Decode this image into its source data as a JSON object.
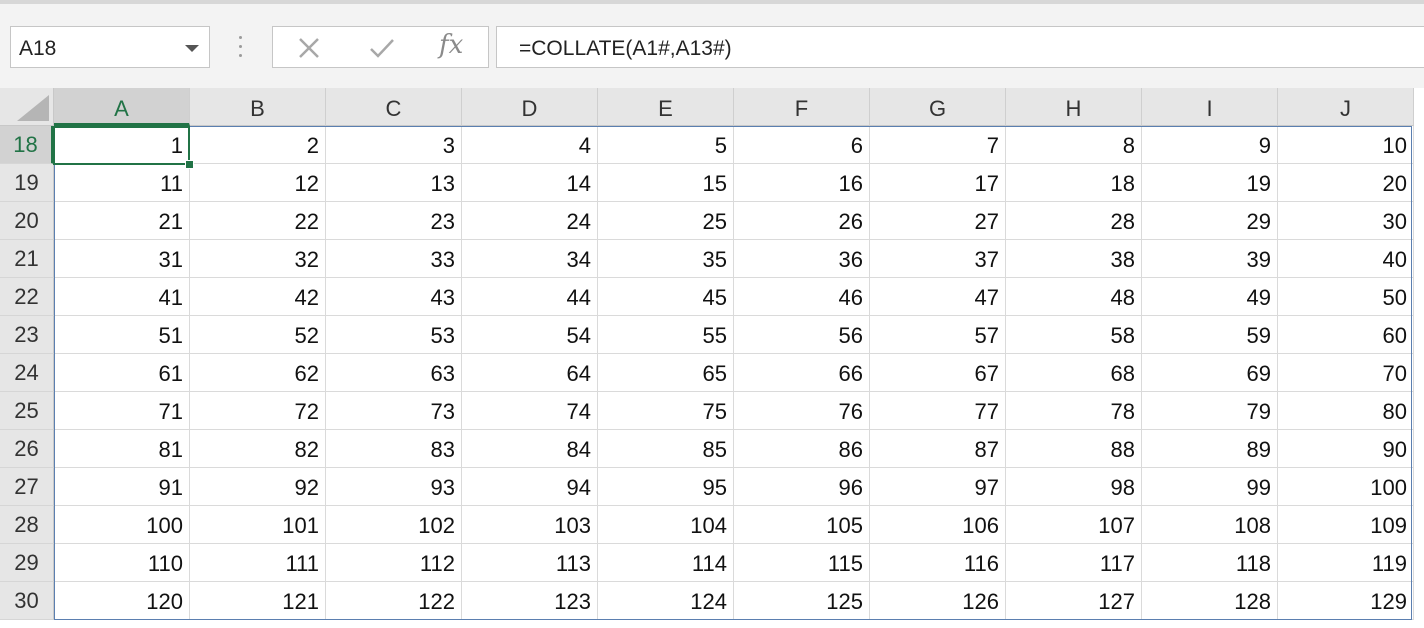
{
  "name_box": {
    "value": "A18"
  },
  "formula_bar": {
    "formula": "=COLLATE(A1#,A13#)",
    "fx_label": "fx"
  },
  "icons": {
    "cancel": "close-icon",
    "enter": "check-icon",
    "function": "fx-icon",
    "dropdown": "chevron-down-icon"
  },
  "colors": {
    "accent": "#217346",
    "spill_border": "#5b7fb0"
  },
  "selected_cell": "A18",
  "columns": [
    "A",
    "B",
    "C",
    "D",
    "E",
    "F",
    "G",
    "H",
    "I",
    "J"
  ],
  "rows": [
    {
      "label": "18",
      "values": [
        "1",
        "2",
        "3",
        "4",
        "5",
        "6",
        "7",
        "8",
        "9",
        "10"
      ]
    },
    {
      "label": "19",
      "values": [
        "11",
        "12",
        "13",
        "14",
        "15",
        "16",
        "17",
        "18",
        "19",
        "20"
      ]
    },
    {
      "label": "20",
      "values": [
        "21",
        "22",
        "23",
        "24",
        "25",
        "26",
        "27",
        "28",
        "29",
        "30"
      ]
    },
    {
      "label": "21",
      "values": [
        "31",
        "32",
        "33",
        "34",
        "35",
        "36",
        "37",
        "38",
        "39",
        "40"
      ]
    },
    {
      "label": "22",
      "values": [
        "41",
        "42",
        "43",
        "44",
        "45",
        "46",
        "47",
        "48",
        "49",
        "50"
      ]
    },
    {
      "label": "23",
      "values": [
        "51",
        "52",
        "53",
        "54",
        "55",
        "56",
        "57",
        "58",
        "59",
        "60"
      ]
    },
    {
      "label": "24",
      "values": [
        "61",
        "62",
        "63",
        "64",
        "65",
        "66",
        "67",
        "68",
        "69",
        "70"
      ]
    },
    {
      "label": "25",
      "values": [
        "71",
        "72",
        "73",
        "74",
        "75",
        "76",
        "77",
        "78",
        "79",
        "80"
      ]
    },
    {
      "label": "26",
      "values": [
        "81",
        "82",
        "83",
        "84",
        "85",
        "86",
        "87",
        "88",
        "89",
        "90"
      ]
    },
    {
      "label": "27",
      "values": [
        "91",
        "92",
        "93",
        "94",
        "95",
        "96",
        "97",
        "98",
        "99",
        "100"
      ]
    },
    {
      "label": "28",
      "values": [
        "100",
        "101",
        "102",
        "103",
        "104",
        "105",
        "106",
        "107",
        "108",
        "109"
      ]
    },
    {
      "label": "29",
      "values": [
        "110",
        "111",
        "112",
        "113",
        "114",
        "115",
        "116",
        "117",
        "118",
        "119"
      ]
    },
    {
      "label": "30",
      "values": [
        "120",
        "121",
        "122",
        "123",
        "124",
        "125",
        "126",
        "127",
        "128",
        "129"
      ]
    }
  ]
}
